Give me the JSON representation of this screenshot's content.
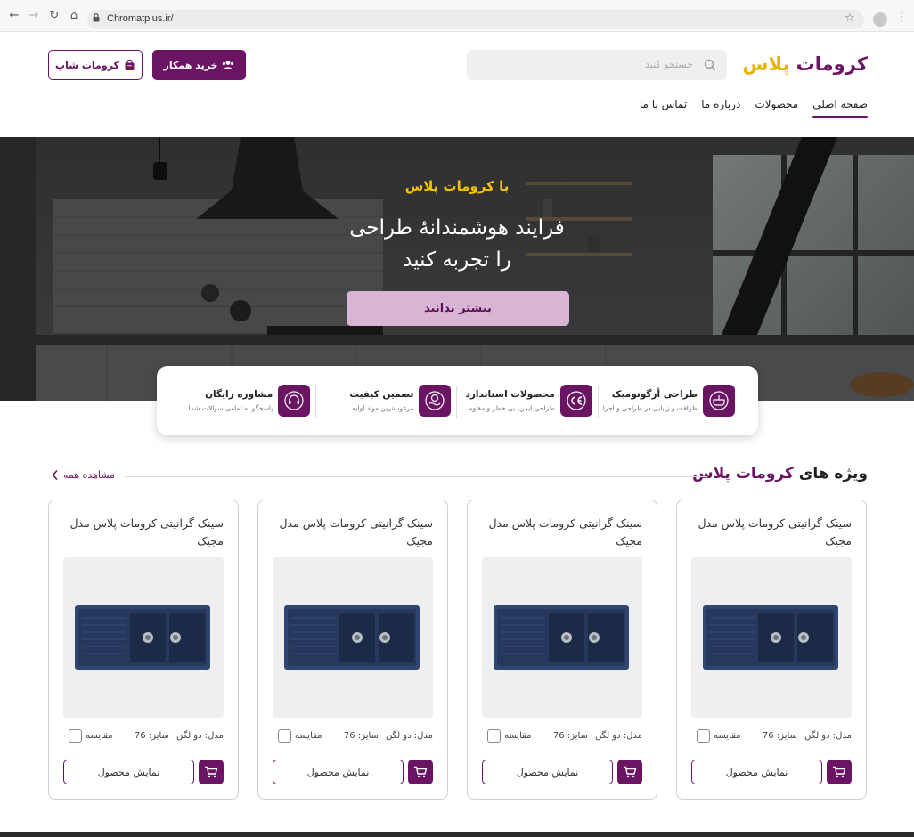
{
  "browser": {
    "url": "Chromatplus.ir/"
  },
  "header": {
    "logo_main": "کرومات",
    "logo_accent": "پلاس",
    "search_placeholder": "جستجو کنید",
    "partner_label": "خرید همکار",
    "shop_label": "کرومات شاپ"
  },
  "nav": {
    "items": [
      {
        "label": "صفحه اصلی",
        "active": true
      },
      {
        "label": "محصولات",
        "active": false
      },
      {
        "label": "درباره ما",
        "active": false
      },
      {
        "label": "تماس با ما",
        "active": false
      }
    ]
  },
  "hero": {
    "kicker": "با  کرومات پلاس",
    "title_line1": "فرایند هوشمندانهٔ طراحی",
    "title_line2": "را تجربه کنید",
    "cta": "بیشتر بدانید"
  },
  "features": [
    {
      "title": "طراحی أرگونومیک",
      "desc": "ظرافت و زیبایی در طراحی و اجرا",
      "icon": "sink-icon"
    },
    {
      "title": "محصولات استاندارد",
      "desc": "طراحی ایمن، بی خطر و مقاوم",
      "icon": "ce-icon"
    },
    {
      "title": "تضمین کیفیت",
      "desc": "مرغوب‌ترین مواد اولیه",
      "icon": "quality-hand-icon"
    },
    {
      "title": "مشاوره رایگان",
      "desc": "پاسخگو به تمامی سوالات شما",
      "icon": "headset-icon"
    }
  ],
  "section": {
    "title_main": "ویژه های",
    "title_accent": "کرومات پلاس",
    "view_all": "مشاهده همه"
  },
  "products": [
    {
      "title": "سینک گرانیتی کرومات پلاس مدل مجیک",
      "model": "مدل: دو لگن",
      "size": "سایز: 76",
      "compare": "مقایسه",
      "show": "نمایش محصول"
    },
    {
      "title": "سینک گرانیتی کرومات پلاس مدل مجیک",
      "model": "مدل: دو لگن",
      "size": "سایز: 76",
      "compare": "مقایسه",
      "show": "نمایش محصول"
    },
    {
      "title": "سینک گرانیتی کرومات پلاس مدل مجیک",
      "model": "مدل: دو لگن",
      "size": "سایز: 76",
      "compare": "مقایسه",
      "show": "نمایش محصول"
    },
    {
      "title": "سینک گرانیتی کرومات پلاس مدل مجیک",
      "model": "مدل: دو لگن",
      "size": "سایز: 76",
      "compare": "مقایسه",
      "show": "نمایش محصول"
    }
  ],
  "colors": {
    "brand": "#6b1463",
    "accent": "#e9b400",
    "cta_bg": "#d8b5d4"
  }
}
